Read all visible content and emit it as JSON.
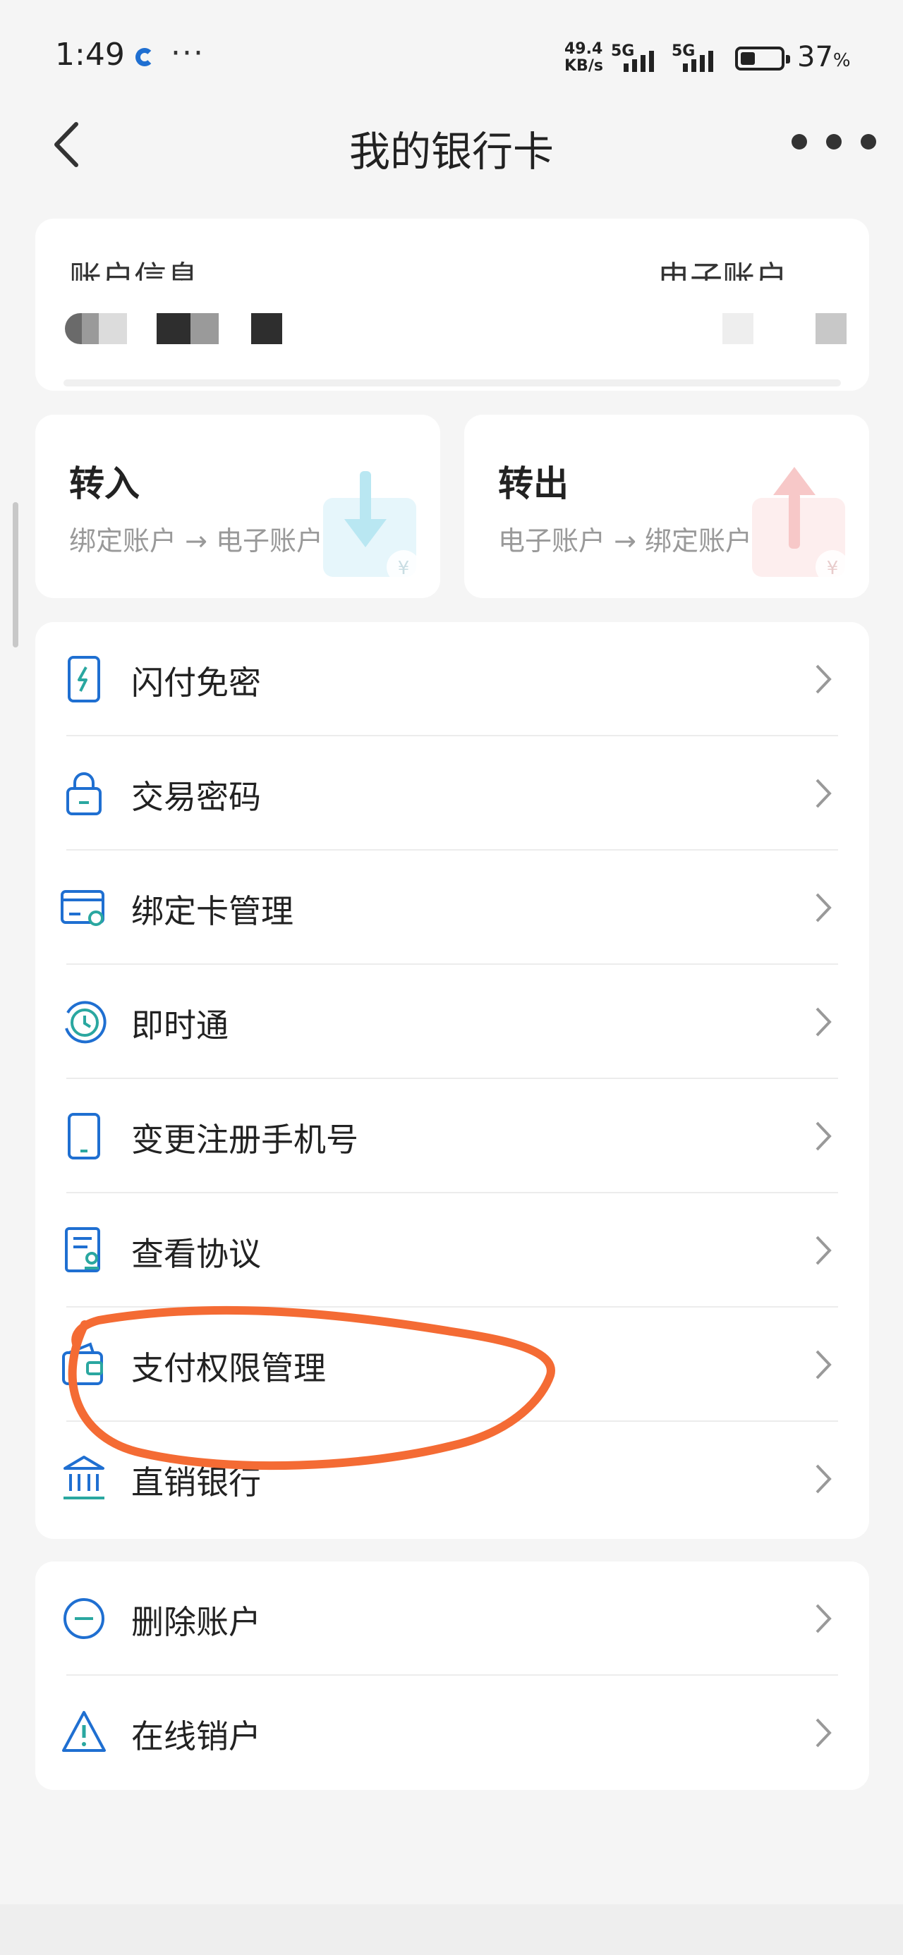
{
  "status_bar": {
    "time": "1:49",
    "net_speed_value": "49.4",
    "net_speed_unit": "KB/s",
    "network_1": "5G",
    "network_2": "5G",
    "battery_percent": "37",
    "battery_unit": "%",
    "battery_level": 0.37
  },
  "header": {
    "title": "我的银行卡"
  },
  "account_card": {
    "left_label": "账户信息",
    "right_label": "电子账户"
  },
  "transfers": [
    {
      "title": "转入",
      "subtitle": "绑定账户 → 电子账户"
    },
    {
      "title": "转出",
      "subtitle": "电子账户 → 绑定账户"
    }
  ],
  "menu_main": [
    {
      "label": "闪付免密",
      "icon": "quickpay-phone-icon"
    },
    {
      "label": "交易密码",
      "icon": "lock-icon"
    },
    {
      "label": "绑定卡管理",
      "icon": "card-settings-icon"
    },
    {
      "label": "即时通",
      "icon": "clock-refresh-icon"
    },
    {
      "label": "变更注册手机号",
      "icon": "phone-icon"
    },
    {
      "label": "查看协议",
      "icon": "document-icon"
    },
    {
      "label": "支付权限管理",
      "icon": "wallet-icon"
    },
    {
      "label": "直销银行",
      "icon": "bank-icon"
    }
  ],
  "menu_account": [
    {
      "label": "删除账户",
      "icon": "minus-circle-icon"
    },
    {
      "label": "在线销户",
      "icon": "warning-icon"
    }
  ],
  "colors": {
    "icon_blue": "#1f6fd1",
    "icon_teal": "#2aa7a0",
    "annotation_orange": "#f46b34",
    "page_bg": "#f5f5f5"
  }
}
